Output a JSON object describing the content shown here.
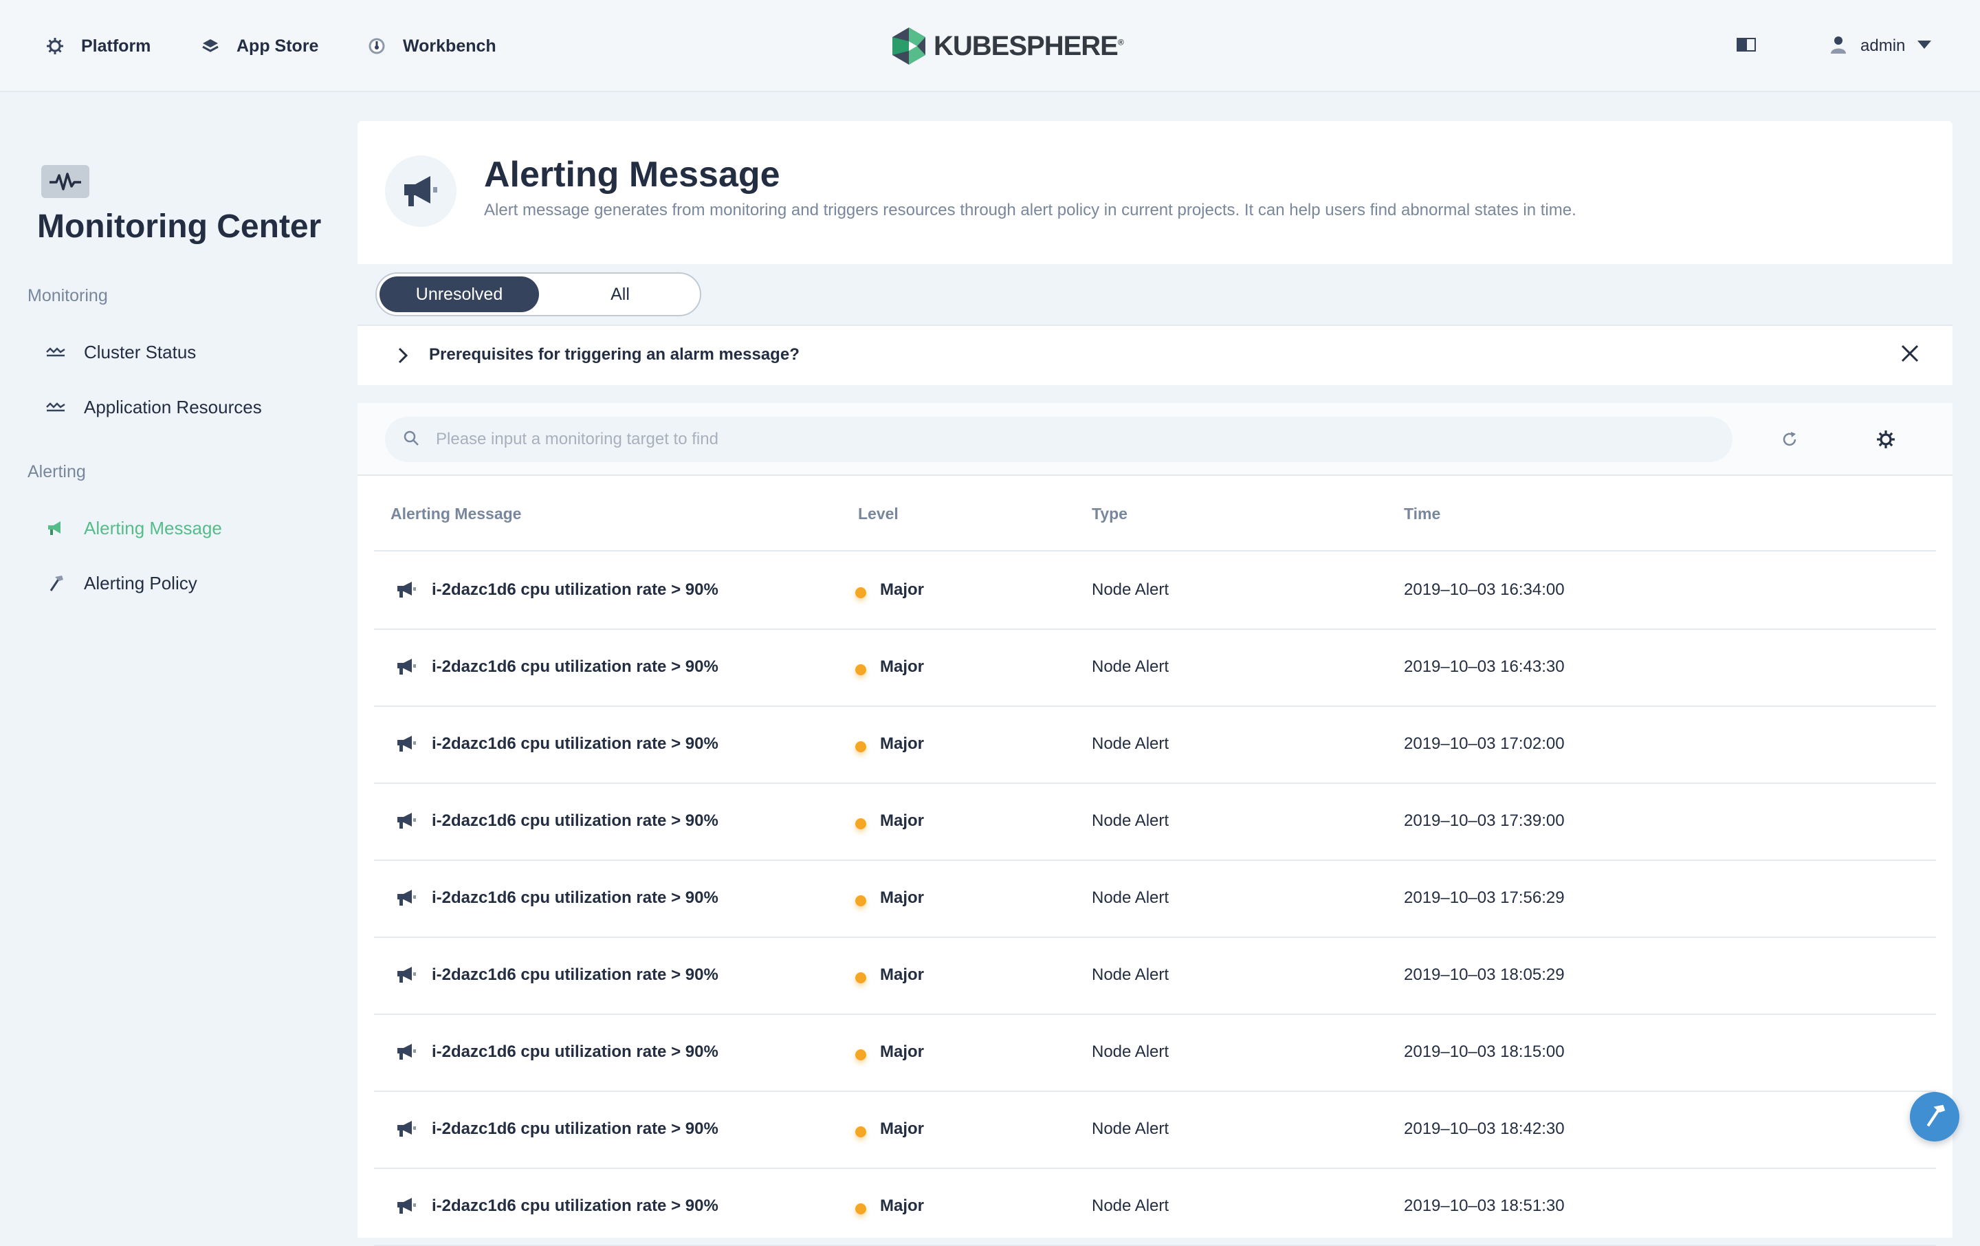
{
  "topbar": {
    "nav": [
      {
        "label": "Platform",
        "icon": "gear-icon"
      },
      {
        "label": "App Store",
        "icon": "layers-icon"
      },
      {
        "label": "Workbench",
        "icon": "dashboard-icon"
      }
    ],
    "brand": "KUBESPHERE",
    "brand_mark": "®",
    "user": "admin"
  },
  "sidebar": {
    "title": "Monitoring Center",
    "groups": [
      {
        "label": "Monitoring",
        "items": [
          {
            "label": "Cluster Status",
            "icon": "wave-icon"
          },
          {
            "label": "Application Resources",
            "icon": "wave-icon"
          }
        ]
      },
      {
        "label": "Alerting",
        "items": [
          {
            "label": "Alerting Message",
            "icon": "megaphone-icon",
            "active": true
          },
          {
            "label": "Alerting Policy",
            "icon": "hammer-icon"
          }
        ]
      }
    ]
  },
  "header": {
    "title": "Alerting Message",
    "description": "Alert message generates from monitoring and triggers resources through alert policy in current projects. It can help users find abnormal states in time."
  },
  "tabs": {
    "unresolved": "Unresolved",
    "all": "All",
    "selected": "Unresolved"
  },
  "tip": {
    "text": "Prerequisites for triggering an alarm message?"
  },
  "search": {
    "placeholder": "Please input a monitoring target to find",
    "value": ""
  },
  "table": {
    "columns": [
      "Alerting Message",
      "Level",
      "Type",
      "Time"
    ],
    "rows": [
      {
        "message": "i-2dazc1d6 cpu utilization rate > 90%",
        "level": "Major",
        "type": "Node Alert",
        "time": "2019–10–03 16:34:00"
      },
      {
        "message": "i-2dazc1d6 cpu utilization rate > 90%",
        "level": "Major",
        "type": "Node Alert",
        "time": "2019–10–03 16:43:30"
      },
      {
        "message": "i-2dazc1d6 cpu utilization rate > 90%",
        "level": "Major",
        "type": "Node Alert",
        "time": "2019–10–03 17:02:00"
      },
      {
        "message": "i-2dazc1d6 cpu utilization rate > 90%",
        "level": "Major",
        "type": "Node Alert",
        "time": "2019–10–03 17:39:00"
      },
      {
        "message": "i-2dazc1d6 cpu utilization rate > 90%",
        "level": "Major",
        "type": "Node Alert",
        "time": "2019–10–03 17:56:29"
      },
      {
        "message": "i-2dazc1d6 cpu utilization rate > 90%",
        "level": "Major",
        "type": "Node Alert",
        "time": "2019–10–03 18:05:29"
      },
      {
        "message": "i-2dazc1d6 cpu utilization rate > 90%",
        "level": "Major",
        "type": "Node Alert",
        "time": "2019–10–03 18:15:00"
      },
      {
        "message": "i-2dazc1d6 cpu utilization rate > 90%",
        "level": "Major",
        "type": "Node Alert",
        "time": "2019–10–03 18:42:30"
      },
      {
        "message": "i-2dazc1d6 cpu utilization rate > 90%",
        "level": "Major",
        "type": "Node Alert",
        "time": "2019–10–03 18:51:30"
      }
    ]
  },
  "colors": {
    "accent": "#55bc8a",
    "major": "#f5a623",
    "dark": "#242e42",
    "muted": "#79879c",
    "fab": "#3f8fd2"
  }
}
